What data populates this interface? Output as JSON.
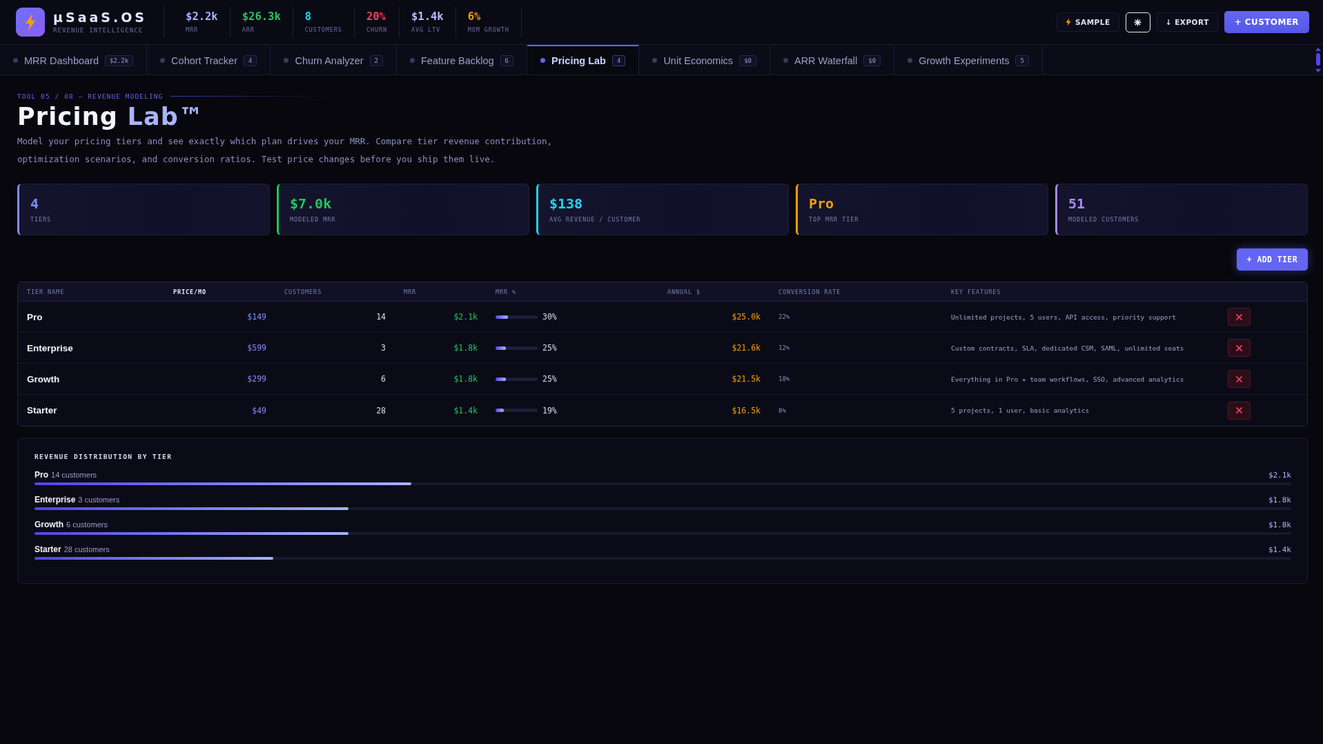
{
  "brand": {
    "name": "µSaaS.OS",
    "tagline": "REVENUE INTELLIGENCE"
  },
  "header_stats": [
    {
      "value": "$2.2k",
      "label": "MRR",
      "color": "#a5b4fc"
    },
    {
      "value": "$26.3k",
      "label": "ARR",
      "color": "#22c55e"
    },
    {
      "value": "8",
      "label": "CUSTOMERS",
      "color": "#22d3ee"
    },
    {
      "value": "20%",
      "label": "CHURN",
      "color": "#f43f5e"
    },
    {
      "value": "$1.4k",
      "label": "AVG LTV",
      "color": "#c4b5fd"
    },
    {
      "value": "6%",
      "label": "MOM GROWTH",
      "color": "#f59e0b"
    }
  ],
  "header_actions": [
    {
      "kind": "bolt",
      "label": "SAMPLE"
    },
    {
      "kind": "icon",
      "focused": true
    },
    {
      "kind": "ghost",
      "label": "↓ EXPORT"
    },
    {
      "kind": "primary",
      "label": "+ CUSTOMER"
    }
  ],
  "tabs": [
    {
      "label": "MRR Dashboard",
      "badge": "$2.2k",
      "selected": false
    },
    {
      "label": "Cohort Tracker",
      "badge": "4",
      "selected": false
    },
    {
      "label": "Churn Analyzer",
      "badge": "2",
      "selected": false
    },
    {
      "label": "Feature Backlog",
      "badge": "6",
      "selected": false
    },
    {
      "label": "Pricing Lab",
      "badge": "4",
      "selected": true
    },
    {
      "label": "Unit Economics",
      "badge": "$0",
      "selected": false
    },
    {
      "label": "ARR Waterfall",
      "badge": "$0",
      "selected": false
    },
    {
      "label": "Growth Experiments",
      "badge": "5",
      "selected": false
    }
  ],
  "breadcrumb": "TOOL 05 / 08 — REVENUE MODELING",
  "title": {
    "text": "Pricing",
    "accent": "Lab™"
  },
  "description": "Model your pricing tiers and see exactly which plan drives your MRR. Compare tier revenue contribution, optimization scenarios, and conversion ratios. Test price changes before you ship them live.",
  "stats": [
    {
      "value": "4",
      "label": "TIERS",
      "color": "#818cf8"
    },
    {
      "value": "$7.0k",
      "label": "MODELED MRR",
      "color": "#22c55e"
    },
    {
      "value": "$138",
      "label": "AVG REVENUE / CUSTOMER",
      "color": "#22d3ee"
    },
    {
      "value": "Pro",
      "label": "TOP MRR TIER",
      "color": "#f59e0b"
    },
    {
      "value": "51",
      "label": "MODELED CUSTOMERS",
      "color": "#a78bfa"
    }
  ],
  "add_button": "+ ADD TIER",
  "table": {
    "columns": [
      {
        "label": "TIER NAME",
        "highlighted": false
      },
      {
        "label": "PRICE/MO",
        "highlighted": true
      },
      {
        "label": "CUSTOMERS",
        "highlighted": false
      },
      {
        "label": "MRR",
        "highlighted": false
      },
      {
        "label": "MRR %",
        "highlighted": false
      },
      {
        "label": "ANNUAL $",
        "highlighted": false
      },
      {
        "label": "CONVERSION RATE",
        "highlighted": false
      },
      {
        "label": "KEY FEATURES",
        "highlighted": false
      }
    ],
    "rows": [
      {
        "tier": "Pro",
        "price": "$149",
        "customers": "14",
        "mrr": "$2.1k",
        "mrr_share": {
          "level": 0.3,
          "reading": "30%"
        },
        "annual": "$25.0k",
        "conversion": "22%",
        "features": "Unlimited projects, 5 users, API access, priority support"
      },
      {
        "tier": "Enterprise",
        "price": "$599",
        "customers": "3",
        "mrr": "$1.8k",
        "mrr_share": {
          "level": 0.25,
          "reading": "25%"
        },
        "annual": "$21.6k",
        "conversion": "12%",
        "features": "Custom contracts, SLA, dedicated CSM, SAML, unlimited seats"
      },
      {
        "tier": "Growth",
        "price": "$299",
        "customers": "6",
        "mrr": "$1.8k",
        "mrr_share": {
          "level": 0.25,
          "reading": "25%"
        },
        "annual": "$21.5k",
        "conversion": "18%",
        "features": "Everything in Pro + team workflows, SSO, advanced analytics"
      },
      {
        "tier": "Starter",
        "price": "$49",
        "customers": "28",
        "mrr": "$1.4k",
        "mrr_share": {
          "level": 0.19,
          "reading": "19%"
        },
        "annual": "$16.5k",
        "conversion": "8%",
        "features": "5 projects, 1 user, basic analytics"
      }
    ]
  },
  "distribution": {
    "title": "REVENUE DISTRIBUTION BY TIER",
    "rows": [
      {
        "tier": "Pro",
        "customers": "14 customers",
        "value": "$2.1k",
        "level": 0.3
      },
      {
        "tier": "Enterprise",
        "customers": "3 customers",
        "value": "$1.8k",
        "level": 0.25
      },
      {
        "tier": "Growth",
        "customers": "6 customers",
        "value": "$1.8k",
        "level": 0.25
      },
      {
        "tier": "Starter",
        "customers": "28 customers",
        "value": "$1.4k",
        "level": 0.19
      }
    ]
  }
}
